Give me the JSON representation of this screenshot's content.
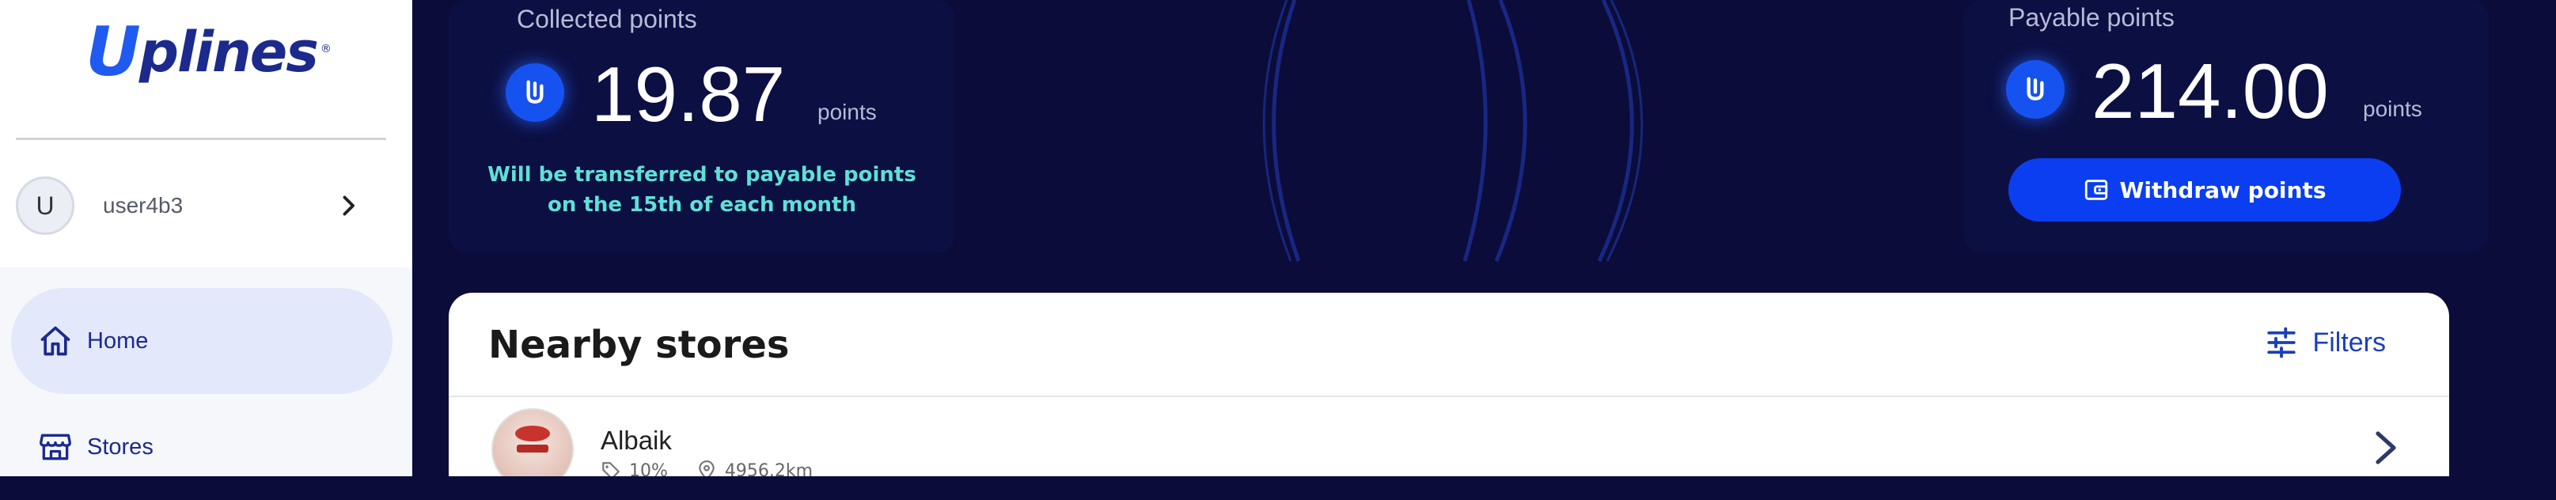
{
  "brand": {
    "logo_mark": "U",
    "logo_text": "plines",
    "registered": "®"
  },
  "user": {
    "avatar_initial": "U",
    "username": "user4b3"
  },
  "nav": {
    "items": [
      {
        "label": "Home",
        "icon": "home-icon",
        "active": true
      },
      {
        "label": "Stores",
        "icon": "store-icon",
        "active": false
      }
    ]
  },
  "collected": {
    "title": "Collected points",
    "value": "19.87",
    "unit": "points",
    "note": "Will be transferred to payable points on the 15th of each month"
  },
  "payable": {
    "title": "Payable points",
    "value": "214.00",
    "unit": "points",
    "withdraw_label": "Withdraw points"
  },
  "stores": {
    "title": "Nearby stores",
    "filters_label": "Filters",
    "items": [
      {
        "name": "Albaik",
        "discount": "10%",
        "distance": "4956.2km"
      }
    ]
  },
  "colors": {
    "accent": "#0a3ef0",
    "background": "#0b0c3a",
    "note_text": "#5fe0d6",
    "brand_dark": "#1b2a8c"
  }
}
